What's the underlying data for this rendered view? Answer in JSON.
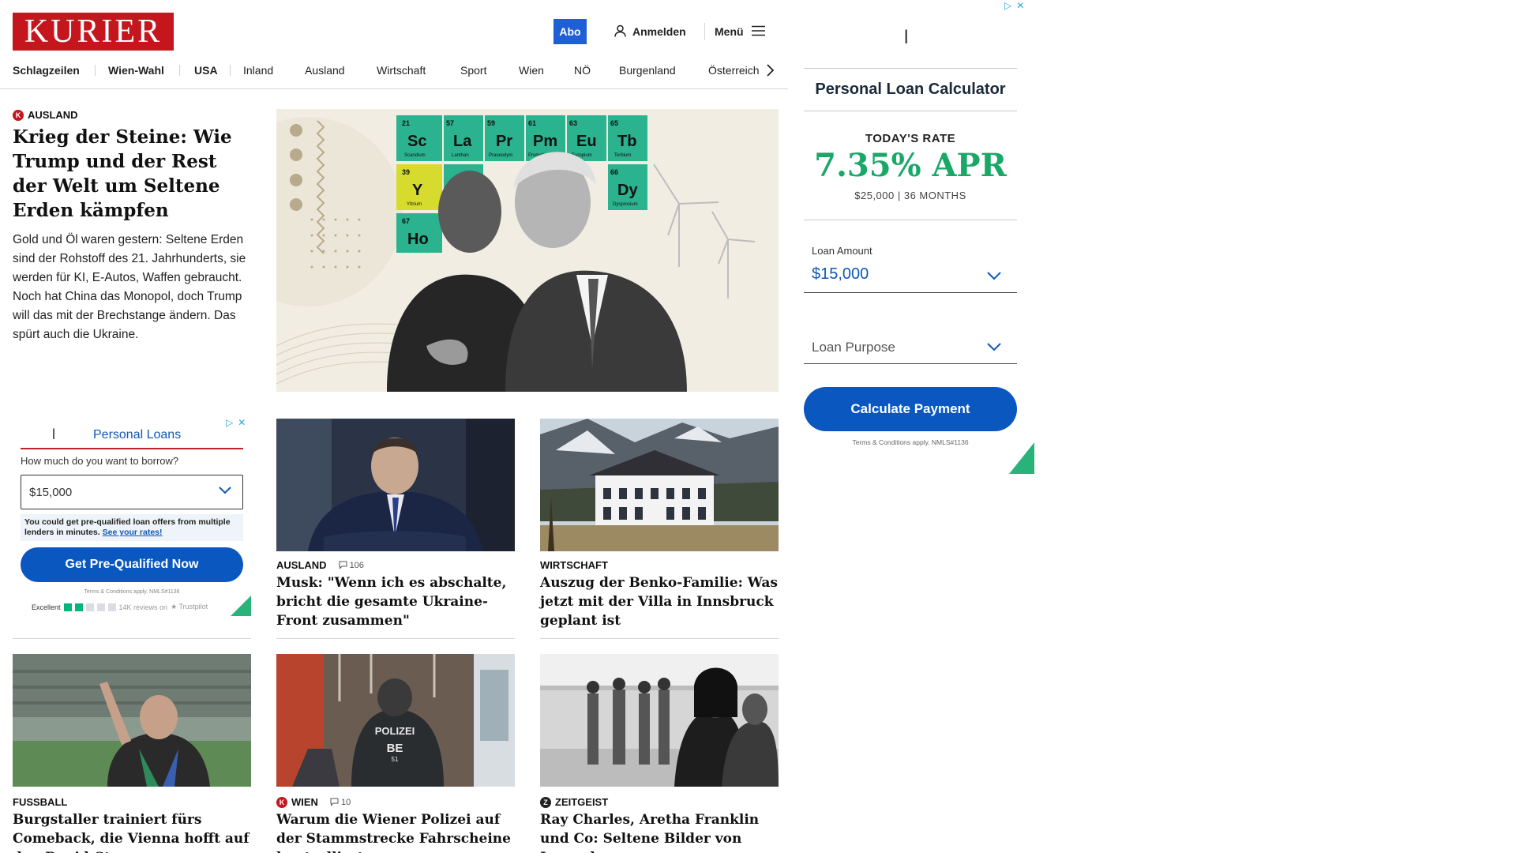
{
  "brand": {
    "logo_text": "KURIER",
    "color": "#c4161c"
  },
  "header": {
    "abo_label": "Abo",
    "login_label": "Anmelden",
    "menu_label": "Menü"
  },
  "nav": {
    "items": [
      {
        "label": "Schlagzeilen"
      },
      {
        "label": "Wien-Wahl"
      },
      {
        "label": "USA"
      },
      {
        "label": "Inland"
      },
      {
        "label": "Ausland"
      },
      {
        "label": "Wirtschaft"
      },
      {
        "label": "Sport"
      },
      {
        "label": "Wien"
      },
      {
        "label": "NÖ"
      },
      {
        "label": "Burgenland"
      },
      {
        "label": "Österreich"
      }
    ]
  },
  "lead": {
    "kicker": "Ausland",
    "title": "Krieg der Steine: Wie Trump und der Rest der Welt um Seltene Erden kämpfen",
    "teaser": "Gold und Öl waren gestern: Seltene Erden sind der Rohstoff des 21. Jahrhunderts, sie werden für KI, E-Autos, Waffen gebraucht. Noch hat China das Monopol, doch Trump will das mit der Brechstange ändern. Das spürt auch die Ukraine.",
    "elements": [
      {
        "num": "21",
        "symbol": "Sc",
        "name": "Scandium"
      },
      {
        "num": "57",
        "symbol": "La",
        "name": "Lanthan"
      },
      {
        "num": "59",
        "symbol": "Pr",
        "name": "Praseodym"
      },
      {
        "num": "61",
        "symbol": "Pm",
        "name": "Promethium"
      },
      {
        "num": "63",
        "symbol": "Eu",
        "name": "Europium"
      },
      {
        "num": "65",
        "symbol": "Tb",
        "name": "Terbium"
      },
      {
        "num": "39",
        "symbol": "Y",
        "name": "Yttrium"
      },
      {
        "num": "66",
        "symbol": "Dy",
        "name": "Dysprosium"
      },
      {
        "num": "67",
        "symbol": "Ho",
        "name": ""
      }
    ]
  },
  "cards": [
    {
      "kicker": "Ausland",
      "comments": "106",
      "title": "Musk: \"Wenn ich es abschalte, bricht die gesamte Ukraine-Front zusammen\""
    },
    {
      "kicker": "Wirtschaft",
      "title": "Auszug der Benko-Familie: Was jetzt mit der Villa in Innsbruck geplant ist"
    },
    {
      "kicker": "Fussball",
      "title": "Burgstaller trainiert fürs Comeback, die Vienna hofft auf den Rapid-Star"
    },
    {
      "kicker": "Wien",
      "comments": "10",
      "title": "Warum die Wiener Polizei auf der Stammstrecke Fahrscheine kontrolliert"
    },
    {
      "kicker": "Zeitgeist",
      "title": "Ray Charles, Aretha Franklin und Co: Seltene Bilder von Legenden"
    }
  ],
  "police_vest": {
    "line1": "POLIZEI",
    "line2": "BE",
    "line3": "51"
  },
  "ad_small": {
    "logo_mark": "l",
    "title": "Personal Loans",
    "question": "How much do you want to borrow?",
    "amount": "$15,000",
    "info": "You could get pre-qualified loan offers from multiple lenders in minutes.",
    "info_link": "See your rates!",
    "cta": "Get Pre-Qualified Now",
    "terms": "Terms & Conditions apply. NMLS#1136",
    "rating_label": "Excellent",
    "reviews": "14K reviews on",
    "trustpilot": "Trustpilot"
  },
  "ad_right": {
    "logo_mark": "l",
    "title": "Personal Loan Calculator",
    "rate_label": "TODAY'S RATE",
    "rate": "7.35% APR",
    "rate_sub": "$25,000 | 36 MONTHS",
    "amount_label": "Loan Amount",
    "amount_value": "$15,000",
    "purpose_placeholder": "Loan Purpose",
    "cta": "Calculate Payment",
    "terms": "Terms & Conditions apply. NMLS#1136"
  }
}
